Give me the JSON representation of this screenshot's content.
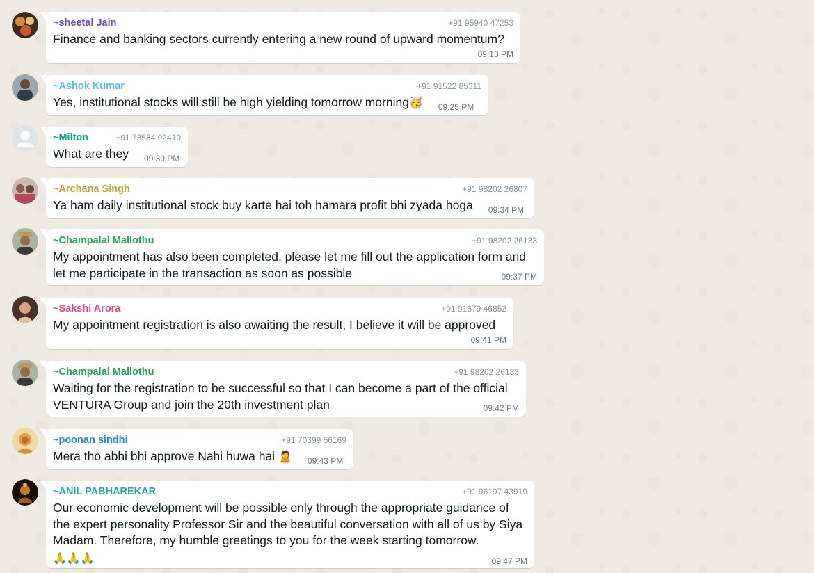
{
  "messages": [
    {
      "sender": "~sheetal Jain",
      "sender_color": "#6e4bc7",
      "phone": "+91 95940 47253",
      "text": "Finance and banking sectors currently entering a new round of upward momentum?",
      "time": "09:13 PM",
      "avatar_color": "#c79a5a"
    },
    {
      "sender": "~Ashok Kumar",
      "sender_color": "#53bdeb",
      "phone": "+91 91522 85311",
      "text": "Yes, institutional stocks will still be high yielding tomorrow morning",
      "emoji": "🥳",
      "time": "09:25 PM",
      "avatar_color": "#5d6b78"
    },
    {
      "sender": "~Milton",
      "sender_color": "#00a884",
      "phone": "+91 73584 92410",
      "text": "What are they",
      "time": "09:30 PM",
      "avatar_color": "#dfe5e7"
    },
    {
      "sender": "~Archana Singh",
      "sender_color": "#c4a035",
      "phone": "+91 98202 26807",
      "text": "Ya ham daily institutional stock buy karte hai toh hamara profit bhi zyada hoga",
      "time": "09:34 PM",
      "avatar_color": "#a47a7a"
    },
    {
      "sender": "~Champalal Mallothu",
      "sender_color": "#1fa855",
      "phone": "+91 98202 26133",
      "text": "My appointment has also been completed, please let me fill out the application form and let me participate in the transaction as soon as possible",
      "time": "09:37 PM",
      "avatar_color": "#8a7a5a"
    },
    {
      "sender": "~Sakshi Arora",
      "sender_color": "#e9417e",
      "phone": "+91 91679 46852",
      "text": "My appointment registration is also awaiting the result, I believe it will be approved",
      "time": "09:41 PM",
      "avatar_color": "#b06a50"
    },
    {
      "sender": "~Champalal Mallothu",
      "sender_color": "#1fa855",
      "phone": "+91 98202 26133",
      "text": "Waiting for the registration to be successful so that I can become a part of the official VENTURA Group and join the 20th investment plan",
      "time": "09:42 PM",
      "avatar_color": "#8a7a5a"
    },
    {
      "sender": "~poonan sindhi",
      "sender_color": "#1e88e5",
      "phone": "+91 70399 56169",
      "text": "Mera tho abhi bhi approve Nahi huwa hai",
      "emoji": "🙎",
      "time": "09:43 PM",
      "avatar_color": "#e0b040"
    },
    {
      "sender": "~ANIL PABHAREKAR",
      "sender_color": "#1fa8a0",
      "phone": "+91 96197 43919",
      "text": "Our economic development will be possible only through the appropriate guidance of the expert personality Professor Sir and the beautiful conversation with all of us by Siya Madam. Therefore, my humble greetings to you for the week starting tomorrow.",
      "emoji_line": "🙏🙏🙏",
      "time": "09:47 PM",
      "avatar_color": "#3a2010"
    }
  ]
}
